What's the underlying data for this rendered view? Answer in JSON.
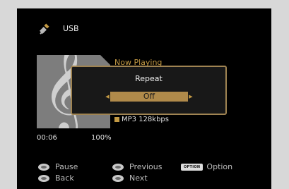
{
  "header": {
    "source_icon": "usb-plug-icon",
    "source_label": "USB"
  },
  "now_playing": {
    "title": "Now Playing",
    "format": "MP3 128kbps",
    "art_icon": "treble-clef-icon",
    "elapsed": "00:06",
    "progress": "100%"
  },
  "dialog": {
    "title": "Repeat",
    "value": "Off",
    "left_arrow_icon": "left-arrow-icon",
    "right_arrow_icon": "right-arrow-icon"
  },
  "hints": {
    "pause": "Pause",
    "back": "Back",
    "previous": "Previous",
    "next": "Next",
    "option_badge": "OPTION",
    "option": "Option"
  },
  "colors": {
    "accent": "#c49a44",
    "highlight": "#b08a4a",
    "background": "#000000",
    "frame": "#d8d8d8"
  }
}
